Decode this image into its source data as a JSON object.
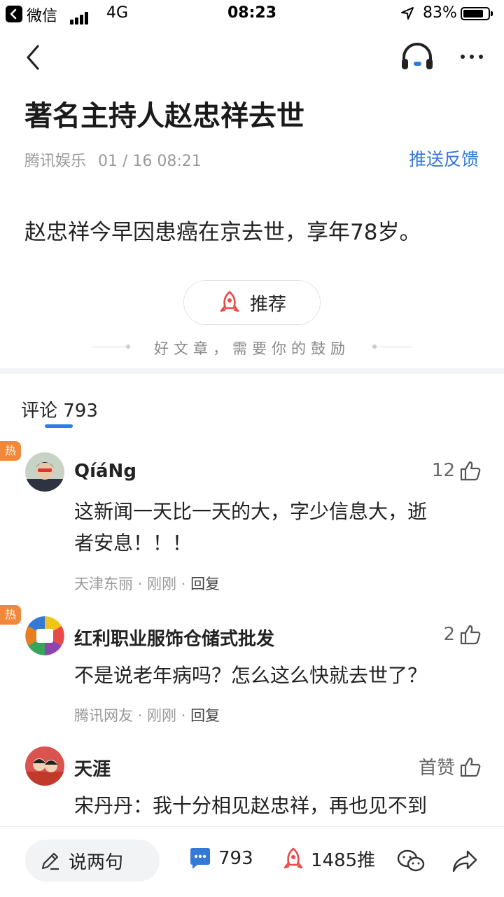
{
  "status_bar": {
    "app_name": "微信",
    "network": "4G",
    "time": "08:23",
    "battery": "83%",
    "battery_level": 0.83
  },
  "article": {
    "title": "著名主持人赵忠祥去世",
    "source": "腾讯娱乐",
    "date": "01 / 16 08:21",
    "feedback_label": "推送反馈",
    "body": "赵忠祥今早因患癌在京去世，享年78岁。",
    "recommend_label": "推荐",
    "encourage_text": "好文章，需要你的鼓励"
  },
  "comments": {
    "tab_label": "评论 793",
    "items": [
      {
        "hot_badge": "热",
        "username": "QíáNg",
        "likes": "12",
        "text_line1": "这新闻一天比一天的大，字少信息大，逝",
        "text_line2": "者安息！！！",
        "location": "天津东丽",
        "time": "刚刚",
        "reply_label": "回复"
      },
      {
        "hot_badge": "热",
        "username": "红利职业服饰仓储式批发",
        "likes": "2",
        "text_line1": "不是说老年病吗？怎么这么快就去世了？",
        "location": "腾讯网友",
        "time": "刚刚",
        "reply_label": "回复"
      },
      {
        "username": "天涯",
        "likes": "首赞",
        "text_line1": "宋丹丹：我十分相见赵忠祥，再也见不到"
      }
    ]
  },
  "bottom_bar": {
    "say_label": "说两句",
    "comment_count": "793",
    "recommend_count": "1485推"
  },
  "colors": {
    "accent_blue": "#3579d6",
    "hot_orange": "#f0873a",
    "recommend_red": "#e94a4a"
  }
}
